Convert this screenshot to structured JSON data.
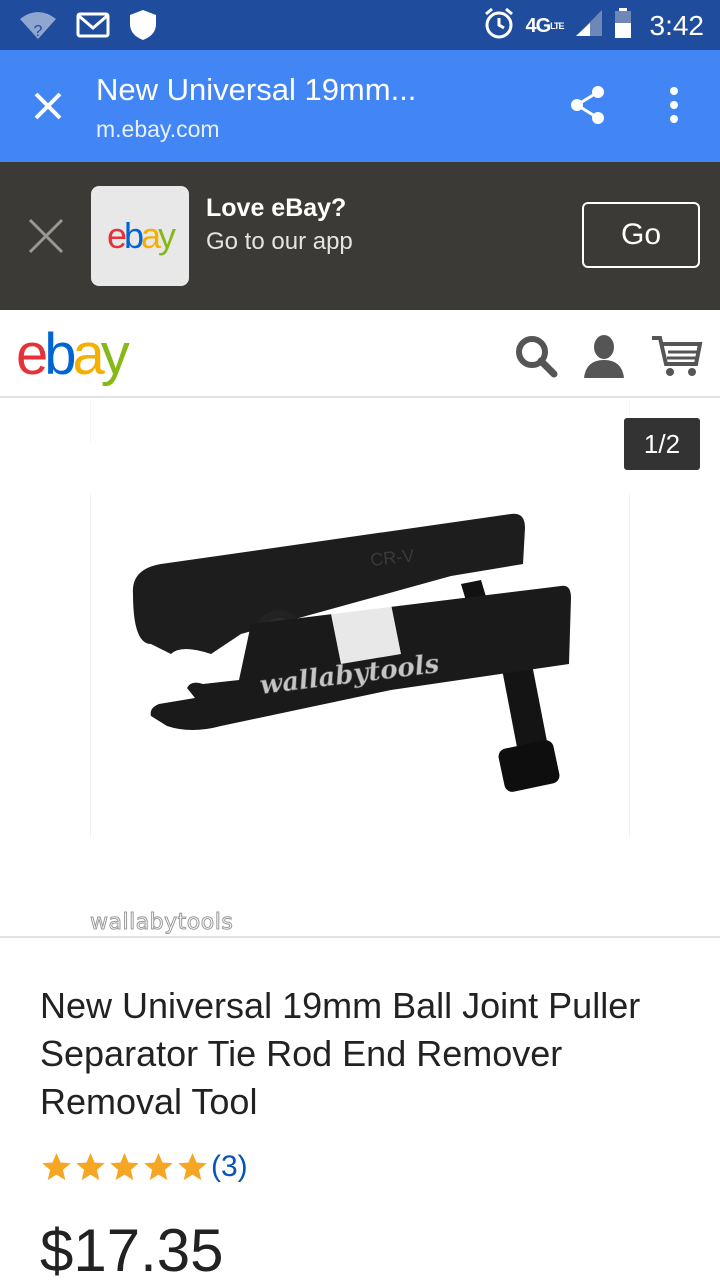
{
  "status_bar": {
    "time": "3:42",
    "network": "4G",
    "network_sub": "LTE",
    "wifi_badge": "?",
    "icons": [
      "wifi-icon",
      "gmail-icon",
      "shield-icon",
      "alarm-icon",
      "signal-icon",
      "battery-icon"
    ]
  },
  "tab_bar": {
    "title": "New Universal 19mm...",
    "url": "m.ebay.com",
    "icons": [
      "close-icon",
      "share-icon",
      "more-vert-icon"
    ],
    "color": "#4285f4"
  },
  "app_banner": {
    "app_logo": "ebay",
    "title": "Love eBay?",
    "subtitle": "Go to our app",
    "go_label": "Go"
  },
  "header": {
    "logo": {
      "e": "e",
      "b": "b",
      "a": "a",
      "y": "y"
    },
    "icons": [
      "search-icon",
      "account-icon",
      "cart-icon"
    ],
    "brand_colors": {
      "e": "#e53238",
      "b": "#0064d2",
      "a": "#f5af02",
      "y": "#86b817"
    }
  },
  "gallery": {
    "counter": "1/2",
    "image_text": "CR-V",
    "image_watermark": "wallabytools",
    "watermark": "wallabytools"
  },
  "product": {
    "title": "New Universal 19mm Ball Joint Puller Separator Tie Rod End Remover Removal Tool",
    "rating_stars": 5,
    "rating_max": 5,
    "review_count": "(3)",
    "price": "$17.35",
    "star_color": "#f5a623"
  }
}
